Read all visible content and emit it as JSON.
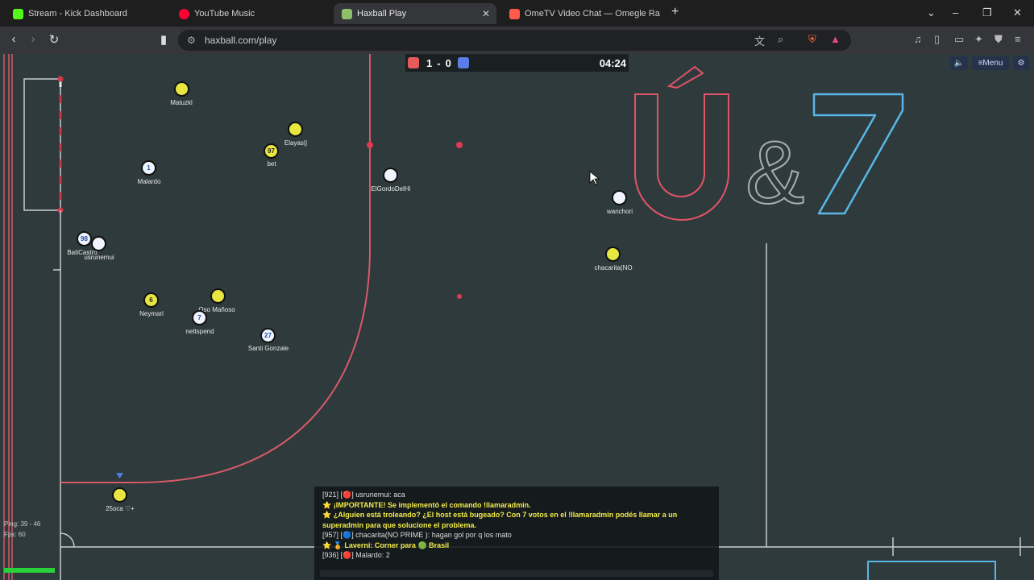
{
  "tabs": [
    {
      "title": "Stream - Kick Dashboard",
      "color": "#53fc18"
    },
    {
      "title": "YouTube Music",
      "color": "#ff0033"
    },
    {
      "title": "Haxball Play",
      "color": "#8fbf6a"
    },
    {
      "title": "OmeTV Video Chat — Omegle Ra",
      "color": "#ff5a4a"
    }
  ],
  "address": {
    "url": "haxball.com/play"
  },
  "scoreboard": {
    "red_score": "1",
    "separator": "-",
    "blue_score": "0",
    "time": "04:24",
    "red_color": "#e55b5b",
    "blue_color": "#5b7de5"
  },
  "controls": {
    "sound_icon": "speaker-icon",
    "menu_label": "≡Menu",
    "settings_icon": "gear-icon"
  },
  "players": [
    {
      "name": "Matuzkl",
      "number": "",
      "team": "yellow"
    },
    {
      "name": "Elayas||",
      "number": "",
      "team": "yellow"
    },
    {
      "name": "bet",
      "number": "97",
      "team": "yellow"
    },
    {
      "name": "Malardo",
      "number": "1",
      "team": "white"
    },
    {
      "name": "ElGordoDelHi",
      "number": "",
      "team": "white"
    },
    {
      "name": "wanchori",
      "number": "",
      "team": "white"
    },
    {
      "name": "chacarita(NO",
      "number": "",
      "team": "yellow"
    },
    {
      "name": "BatiCastro",
      "number": "98",
      "team": "white"
    },
    {
      "name": "usrunemui",
      "number": "",
      "team": "white"
    },
    {
      "name": "Neymarl",
      "number": "6",
      "team": "yellow"
    },
    {
      "name": "Oso Mañoso",
      "number": "",
      "team": "yellow"
    },
    {
      "name": "nettspend",
      "number": "7",
      "team": "white"
    },
    {
      "name": "Santi Gonzale",
      "number": "27",
      "team": "white"
    },
    {
      "name": "25oca ♡+",
      "number": "",
      "team": "yellow"
    }
  ],
  "chat": [
    {
      "text": "[921] [🔴] usrunemui: aca",
      "style": "normal"
    },
    {
      "text": "⭐ ¡IMPORTANTE! Se implementó el comando !llamaradmin.",
      "style": "announce"
    },
    {
      "text": "⭐ ¿Alguien está troleando? ¿El host está bugeado? Con 7 votos en el !llamaradmin podés llamar a un",
      "style": "announce"
    },
    {
      "text": "superadmin para que solucione el problema.",
      "style": "announce"
    },
    {
      "text": "[957] [🔵] chacarita(NO PRIME ): hagan gol por q los mato",
      "style": "normal"
    },
    {
      "text": "⭐ 🏅 Laverni: Corner para 🟢 Brasil",
      "style": "announce"
    },
    {
      "text": "[936] [🔴] Malardo: 2",
      "style": "normal"
    }
  ],
  "stats": {
    "ping": "Ping: 39 - 46",
    "fps": "Fps: 60"
  }
}
